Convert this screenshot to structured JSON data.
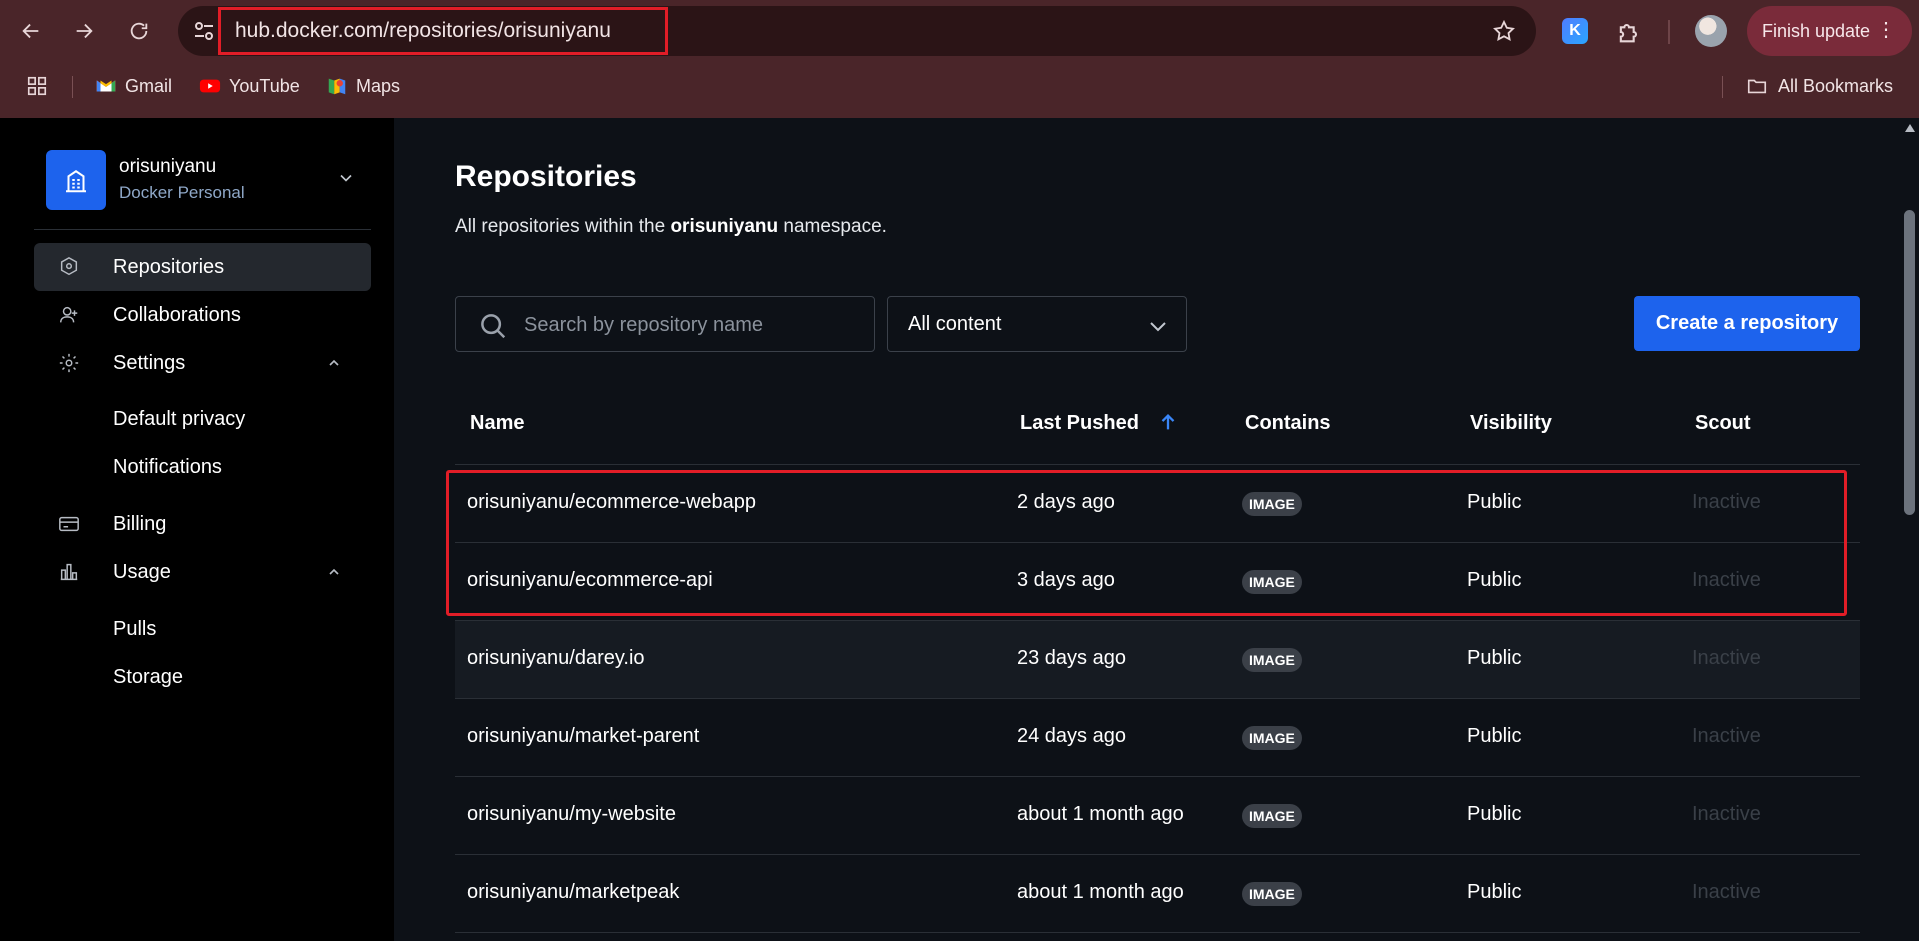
{
  "browser": {
    "url": "hub.docker.com/repositories/orisuniyanu",
    "finish_update": "Finish update",
    "extension_label": "K",
    "bookmarks": [
      {
        "label": "Gmail",
        "icon": "gmail-icon"
      },
      {
        "label": "YouTube",
        "icon": "youtube-icon"
      },
      {
        "label": "Maps",
        "icon": "maps-icon"
      }
    ],
    "all_bookmarks": "All Bookmarks"
  },
  "sidebar": {
    "org_name": "orisuniyanu",
    "org_type": "Docker Personal",
    "items": [
      {
        "label": "Repositories",
        "icon": "repositories-icon"
      },
      {
        "label": "Collaborations",
        "icon": "collaborations-icon"
      },
      {
        "label": "Settings",
        "icon": "settings-icon"
      },
      {
        "label": "Default privacy"
      },
      {
        "label": "Notifications"
      },
      {
        "label": "Billing",
        "icon": "billing-icon"
      },
      {
        "label": "Usage",
        "icon": "usage-icon"
      },
      {
        "label": "Pulls"
      },
      {
        "label": "Storage"
      }
    ]
  },
  "main": {
    "title": "Repositories",
    "subtitle_prefix": "All repositories within the",
    "namespace": "orisuniyanu",
    "subtitle_suffix": "namespace.",
    "search_placeholder": "Search by repository name",
    "filter_value": "All content",
    "create_button": "Create a repository"
  },
  "table": {
    "columns": [
      "Name",
      "Last Pushed",
      "Contains",
      "Visibility",
      "Scout"
    ],
    "rows": [
      {
        "name": "orisuniyanu/ecommerce-webapp",
        "pushed": "2 days ago",
        "contains": "IMAGE",
        "visibility": "Public",
        "scout": "Inactive"
      },
      {
        "name": "orisuniyanu/ecommerce-api",
        "pushed": "3 days ago",
        "contains": "IMAGE",
        "visibility": "Public",
        "scout": "Inactive"
      },
      {
        "name": "orisuniyanu/darey.io",
        "pushed": "23 days ago",
        "contains": "IMAGE",
        "visibility": "Public",
        "scout": "Inactive"
      },
      {
        "name": "orisuniyanu/market-parent",
        "pushed": "24 days ago",
        "contains": "IMAGE",
        "visibility": "Public",
        "scout": "Inactive"
      },
      {
        "name": "orisuniyanu/my-website",
        "pushed": "about 1 month ago",
        "contains": "IMAGE",
        "visibility": "Public",
        "scout": "Inactive"
      },
      {
        "name": "orisuniyanu/marketpeak",
        "pushed": "about 1 month ago",
        "contains": "IMAGE",
        "visibility": "Public",
        "scout": "Inactive"
      }
    ]
  },
  "colors": {
    "accent": "#1d63ed",
    "highlight_box": "#e11d27",
    "chrome": "#4a2529"
  }
}
